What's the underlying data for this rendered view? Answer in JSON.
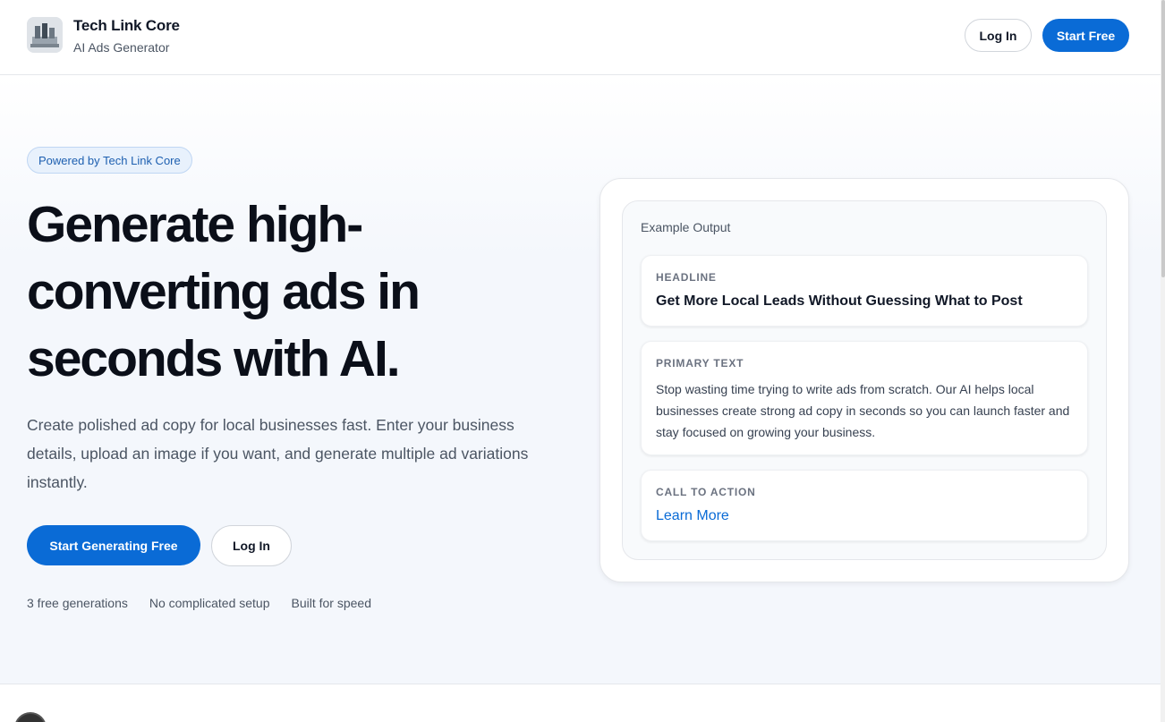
{
  "header": {
    "brand_name": "Tech Link Core",
    "brand_sub": "AI Ads Generator",
    "login_label": "Log In",
    "start_label": "Start Free"
  },
  "hero": {
    "pill": "Powered by Tech Link Core",
    "headline": "Generate high-converting ads in seconds with AI.",
    "lead": "Create polished ad copy for local businesses fast. Enter your business details, upload an image if you want, and generate multiple ad variations instantly.",
    "primary_cta": "Start Generating Free",
    "secondary_cta": "Log In",
    "features": [
      "3 free generations",
      "No complicated setup",
      "Built for speed"
    ]
  },
  "example": {
    "title": "Example Output",
    "headline_label": "HEADLINE",
    "headline_value": "Get More Local Leads Without Guessing What to Post",
    "primary_label": "PRIMARY TEXT",
    "primary_value": "Stop wasting time trying to write ads from scratch. Our AI helps local businesses create strong ad copy in seconds so you can launch faster and stay focused on growing your business.",
    "cta_label": "CALL TO ACTION",
    "cta_value": "Learn More"
  },
  "colors": {
    "accent": "#0a6bd6",
    "hero_bg": "#f4f7fc"
  }
}
